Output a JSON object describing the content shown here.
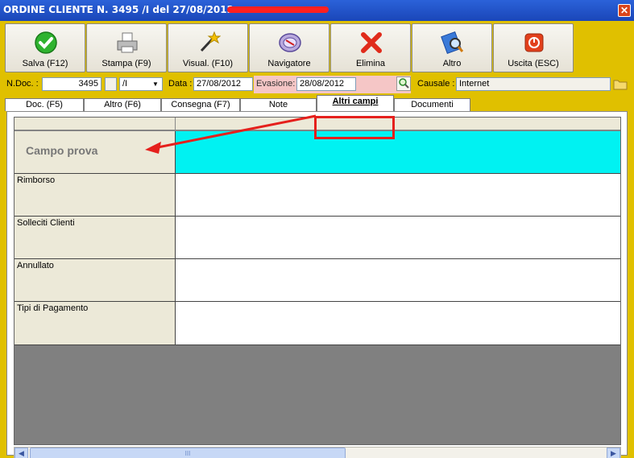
{
  "window": {
    "title": "ORDINE CLIENTE N. 3495 /I del 27/08/2012 - ",
    "close_label": "✕"
  },
  "toolbar": {
    "buttons": [
      {
        "label": "Salva (F12)",
        "icon": "check-icon"
      },
      {
        "label": "Stampa (F9)",
        "icon": "printer-icon"
      },
      {
        "label": "Visual. (F10)",
        "icon": "magic-wand-icon"
      },
      {
        "label": "Navigatore",
        "icon": "compass-icon"
      },
      {
        "label": "Elimina",
        "icon": "delete-x-icon"
      },
      {
        "label": "Altro",
        "icon": "search-document-icon"
      },
      {
        "label": "Uscita (ESC)",
        "icon": "exit-icon"
      }
    ]
  },
  "fields": {
    "ndoc_label": "N.Doc. :",
    "ndoc_value": "3495",
    "series_value": "/I",
    "data_label": "Data :",
    "data_value": "27/08/2012",
    "evasione_label": "Evasione:",
    "evasione_value": "28/08/2012",
    "causale_label": "Causale :",
    "causale_value": "Internet"
  },
  "tabs": [
    {
      "label": "Doc. (F5)"
    },
    {
      "label": "Altro (F6)"
    },
    {
      "label": "Consegna (F7)"
    },
    {
      "label": "Note"
    },
    {
      "label": "Altri campi"
    },
    {
      "label": "Documenti"
    }
  ],
  "grid": {
    "rows": [
      {
        "label": "Campo prova",
        "value": ""
      },
      {
        "label": "Rimborso",
        "value": ""
      },
      {
        "label": "Solleciti Clienti",
        "value": ""
      },
      {
        "label": "Annullato",
        "value": ""
      },
      {
        "label": "Tipi di Pagamento",
        "value": ""
      }
    ],
    "scroll_grip": "III"
  },
  "colors": {
    "highlight_row": "#00f2f2",
    "annotation": "#e5201c"
  }
}
